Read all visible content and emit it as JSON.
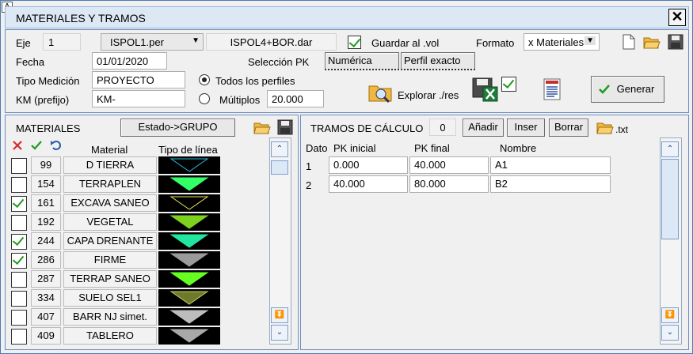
{
  "window": {
    "title": "MATERIALES Y TRAMOS",
    "close_label": "✕",
    "sys_icon": "A"
  },
  "top": {
    "eje_label": "Eje",
    "eje_value": "1",
    "per_file": "ISPOL1.per",
    "dar_file": "ISPOL4+BOR.dar",
    "guardar_vol_label": "Guardar al .vol",
    "guardar_vol_checked": true,
    "formato_label": "Formato",
    "formato_value": "x Materiales",
    "fecha_label": "Fecha",
    "fecha_value": "01/01/2020",
    "seleccion_pk_label": "Selección PK",
    "numerica_label": "Numérica",
    "perfil_exacto_label": "Perfil exacto",
    "tipo_medicion_label": "Tipo Medición",
    "tipo_medicion_value": "PROYECTO",
    "todos_perfiles_label": "Todos los perfiles",
    "km_label": "KM (prefijo)",
    "km_value": "KM-",
    "multiplos_label": "Múltiplos",
    "multiplos_value": "20.000",
    "explorar_label": "Explorar ./res",
    "excel_checked": true,
    "generar_label": "Generar"
  },
  "materiales": {
    "title": "MATERIALES",
    "estado_button": "Estado->GRUPO",
    "col_material": "Material",
    "col_tipo_linea": "Tipo de línea",
    "rows": [
      {
        "checked": false,
        "code": "99",
        "name": "D TIERRA",
        "fill": "#000000",
        "stroke": "#2ab8d8"
      },
      {
        "checked": false,
        "code": "154",
        "name": "TERRAPLEN",
        "fill": "#33ff66",
        "stroke": "#33ff66"
      },
      {
        "checked": true,
        "code": "161",
        "name": "EXCAVA SANEO",
        "fill": "#000000",
        "stroke": "#e6e060"
      },
      {
        "checked": false,
        "code": "192",
        "name": "VEGETAL",
        "fill": "#7cd21e",
        "stroke": "#7cd21e"
      },
      {
        "checked": true,
        "code": "244",
        "name": "CAPA DRENANTE",
        "fill": "#22e6a0",
        "stroke": "#22e6a0"
      },
      {
        "checked": true,
        "code": "286",
        "name": "FIRME",
        "fill": "#9a9a9a",
        "stroke": "#9a9a9a"
      },
      {
        "checked": false,
        "code": "287",
        "name": "TERRAP SANEO",
        "fill": "#66ff22",
        "stroke": "#66ff22"
      },
      {
        "checked": false,
        "code": "334",
        "name": "SUELO SEL1",
        "fill": "#6e7a2a",
        "stroke": "#c6d066"
      },
      {
        "checked": false,
        "code": "407",
        "name": "BARR NJ simet.",
        "fill": "#bdbdbd",
        "stroke": "#bdbdbd"
      },
      {
        "checked": false,
        "code": "409",
        "name": "TABLERO",
        "fill": "#a8a8a8",
        "stroke": "#a8a8a8"
      }
    ]
  },
  "tramos": {
    "title": "TRAMOS DE CÁLCULO",
    "count": "0",
    "anadir": "Añadir",
    "inser": "Inser",
    "borrar": "Borrar",
    "txt_label": ".txt",
    "col_dato": "Dato",
    "col_pk_inicial": "PK inicial",
    "col_pk_final": "PK final",
    "col_nombre": "Nombre",
    "rows": [
      {
        "dato": "1",
        "pk_inicial": "0.000",
        "pk_final": "40.000",
        "nombre": "A1"
      },
      {
        "dato": "2",
        "pk_inicial": "40.000",
        "pk_final": "80.000",
        "nombre": "B2"
      }
    ]
  },
  "colors": {
    "accent_border": "#6c8dc0",
    "title_bg": "#dde8f5",
    "check_green": "#1e9b1e",
    "delete_red": "#d42a2a"
  }
}
